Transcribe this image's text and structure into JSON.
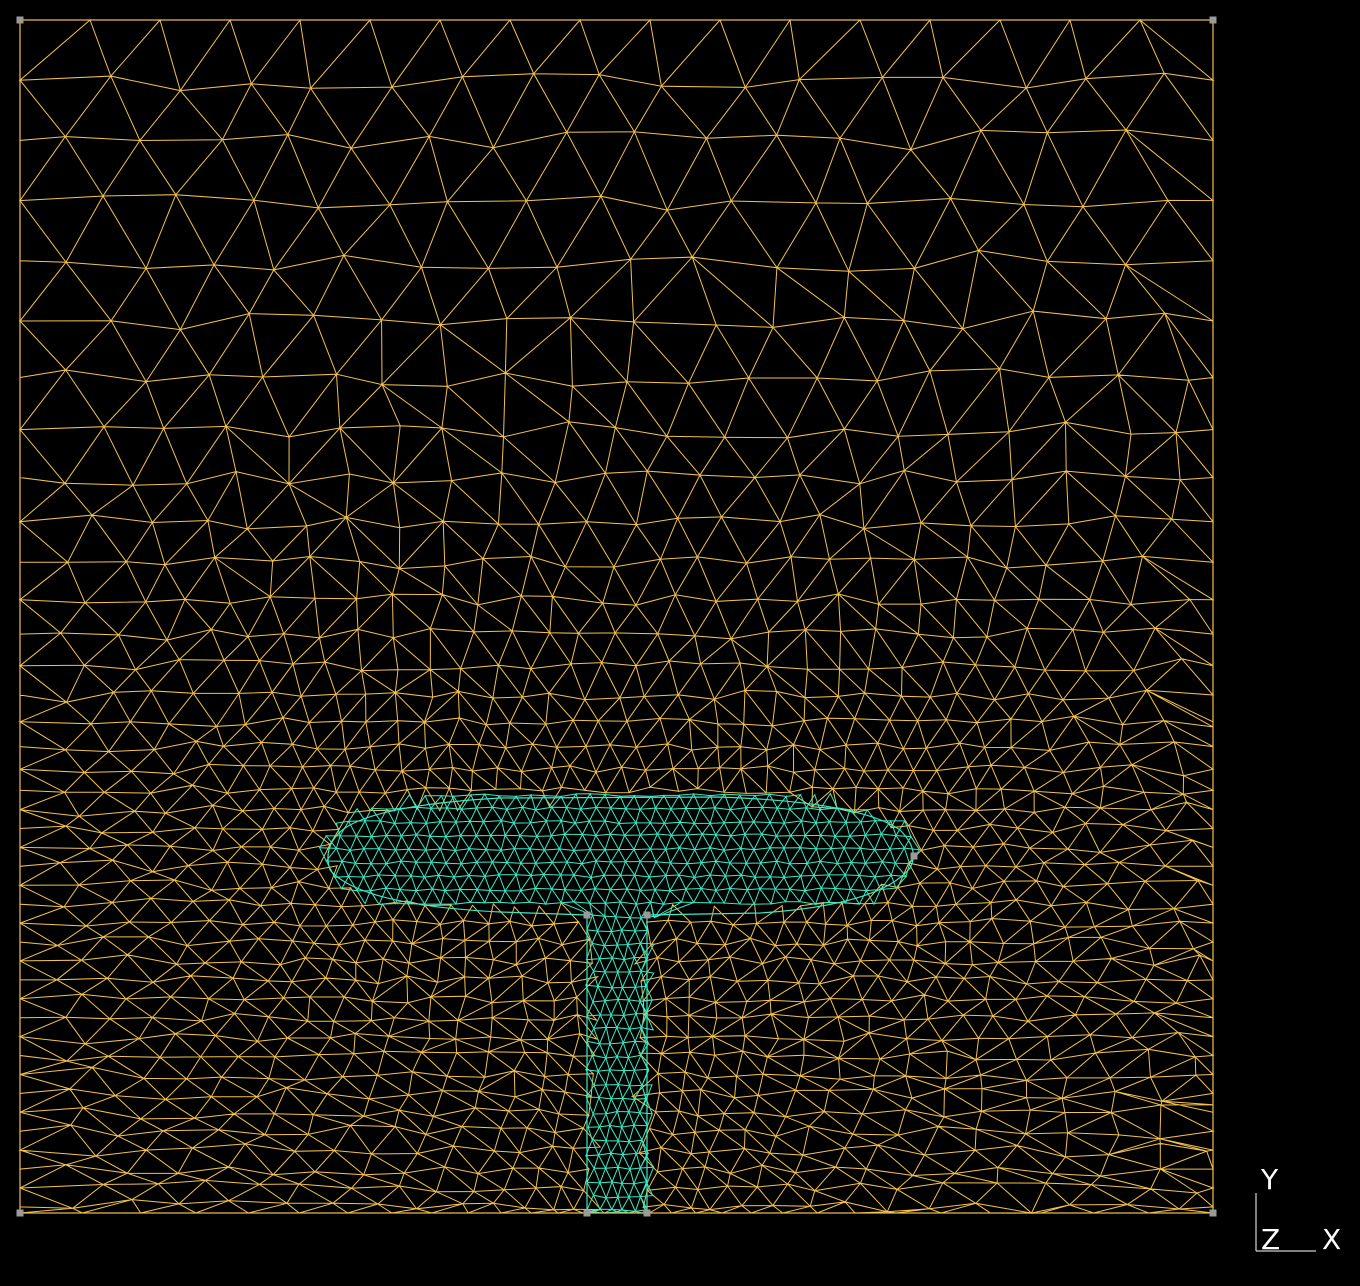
{
  "colors": {
    "background": "#000000",
    "outer_mesh": "#f2c14e",
    "inner_mesh": "#3ee8c4",
    "vertex_marker": "#9a9a9a",
    "axis_text": "#ffffff"
  },
  "axes_triad": {
    "y_label": "Y",
    "z_label": "Z",
    "x_label": "X"
  }
}
